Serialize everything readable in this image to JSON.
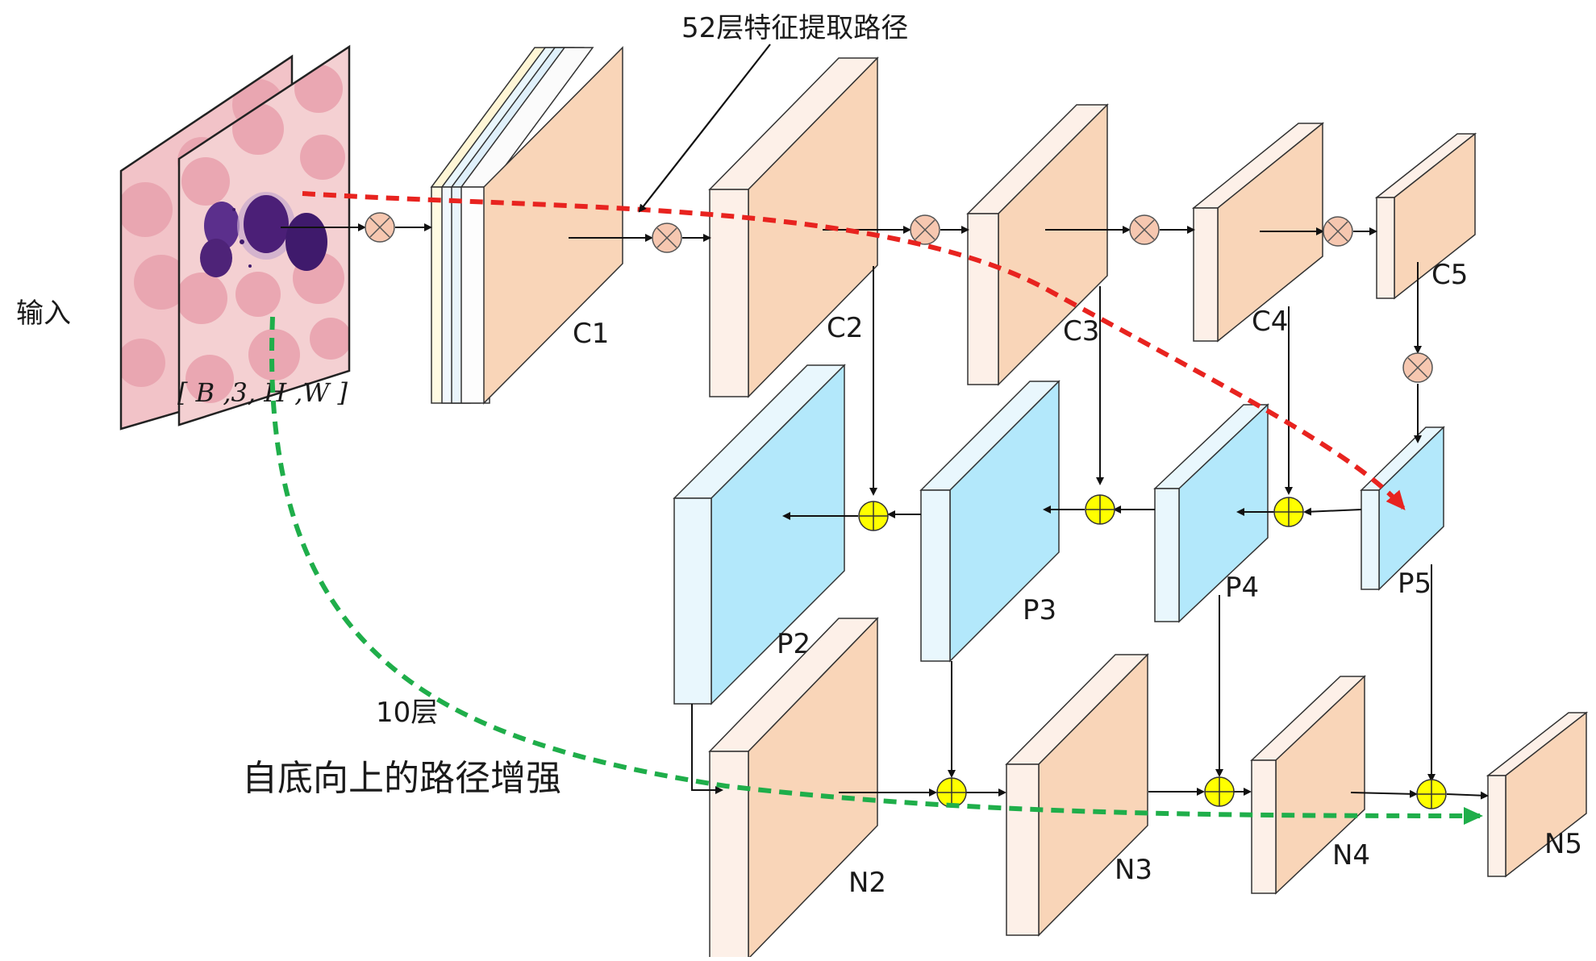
{
  "labels": {
    "input": "输入",
    "tensor_shape": "[ B ,3, H ,W ]",
    "path_52": "52层特征提取路径",
    "path_10": "10层",
    "bottom_up": "自底向上的路径增强"
  },
  "backbone": [
    "C1",
    "C2",
    "C3",
    "C4",
    "C5"
  ],
  "fpn": [
    "P2",
    "P3",
    "P4",
    "P5"
  ],
  "pan": [
    "N2",
    "N3",
    "N4",
    "N5"
  ],
  "colors": {
    "backbone_face": "#f9d5b8",
    "backbone_side": "#fdf0e8",
    "fpn_face": "#b3e8fb",
    "fpn_side": "#e9f7fd",
    "add_op": "#ffff00",
    "mul_op": "#f6c7b0",
    "red_path": "#e8231f",
    "green_path": "#1fae4a"
  },
  "icons": {
    "elementwise_multiply": "circle-times-icon",
    "elementwise_add": "circle-plus-icon"
  }
}
